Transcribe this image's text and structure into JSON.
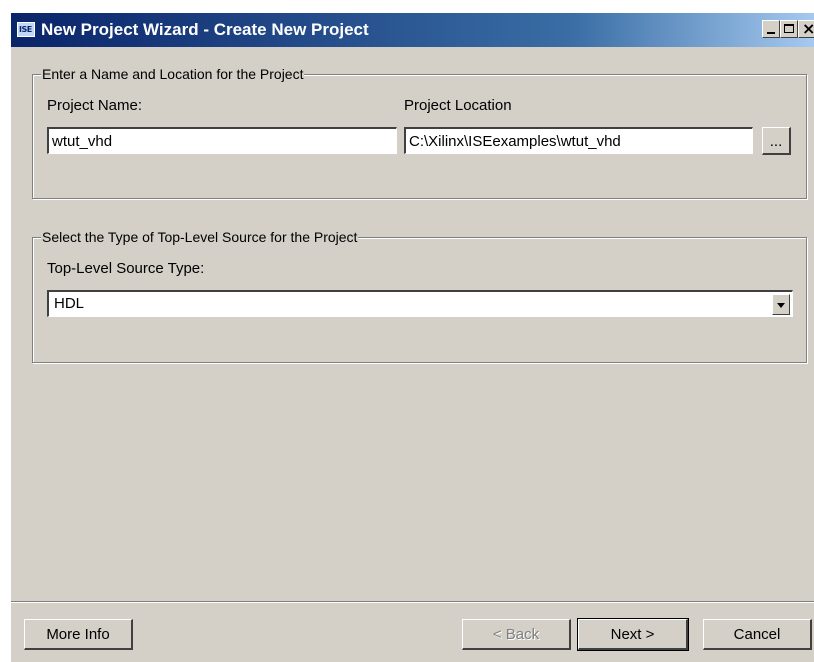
{
  "window": {
    "title": "New Project Wizard - Create New Project",
    "icon_text": "ISE",
    "icons": {
      "app": "ise-app-icon",
      "minimize": "minimize-icon",
      "maximize": "maximize-icon",
      "close": "close-icon"
    }
  },
  "name_location_group": {
    "legend": "Enter a Name and Location for the Project",
    "project_name_label": "Project Name:",
    "project_name_value": "wtut_vhd",
    "project_location_label": "Project Location",
    "project_location_value": "C:\\Xilinx\\ISEexamples\\wtut_vhd",
    "browse_label": "..."
  },
  "source_type_group": {
    "legend": "Select the Type of Top-Level Source for the Project",
    "top_level_label": "Top-Level Source Type:",
    "top_level_value": "HDL"
  },
  "footer": {
    "more_info": "More Info",
    "back": "< Back",
    "next": "Next >",
    "cancel": "Cancel"
  }
}
